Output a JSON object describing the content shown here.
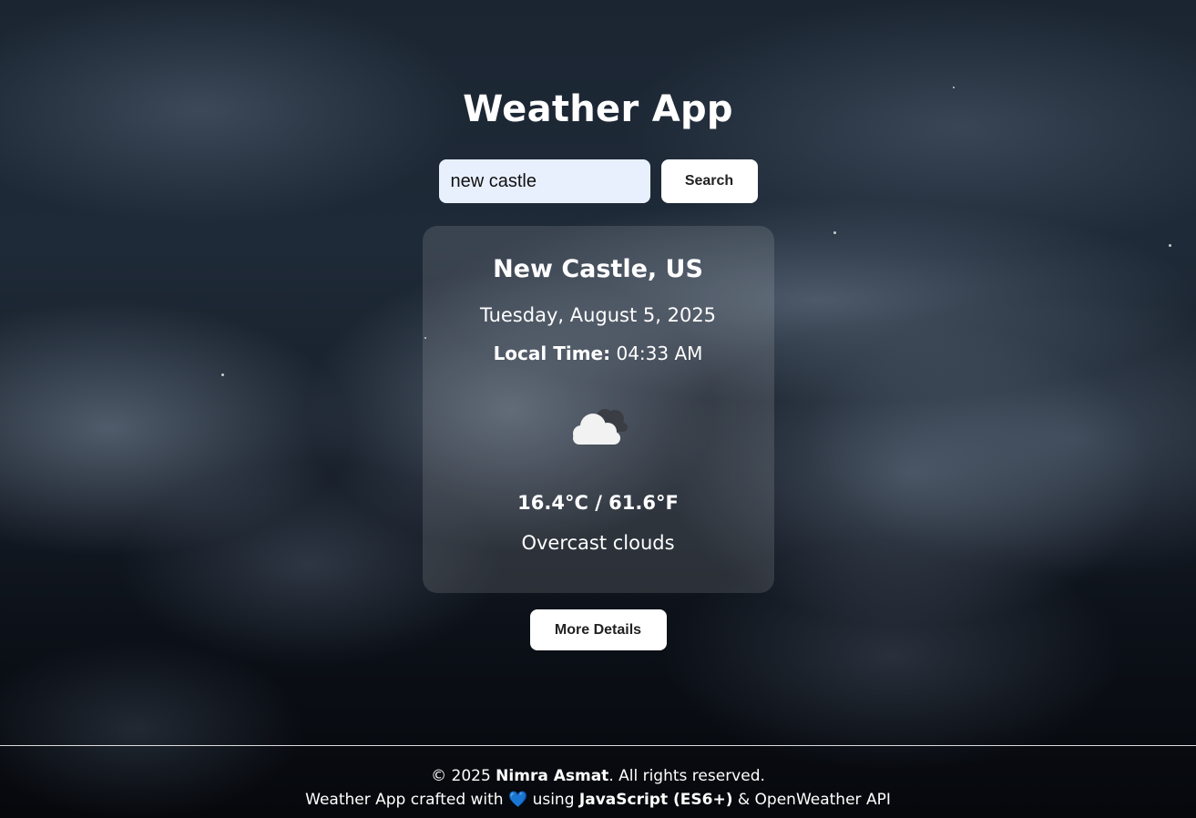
{
  "app": {
    "title": "Weather App"
  },
  "search": {
    "value": "new castle",
    "placeholder": "",
    "button_label": "Search"
  },
  "weather": {
    "city": "New Castle, US",
    "date": "Tuesday, August 5, 2025",
    "local_time_label": "Local Time:",
    "local_time_value": "04:33 AM",
    "icon": "night-cloudy-icon",
    "temperature": "16.4°C / 61.6°F",
    "description": "Overcast clouds"
  },
  "actions": {
    "more_details_label": "More Details"
  },
  "footer": {
    "copyright_prefix": "© 2025",
    "author": "Nimra Asmat",
    "copyright_suffix": ". All rights reserved.",
    "credit_prefix": "Weather App crafted with",
    "heart": "💙",
    "credit_using": "using",
    "tech": "JavaScript (ES6+)",
    "credit_suffix": "& OpenWeather API"
  },
  "colors": {
    "input_bg": "#e8f0fe",
    "button_bg": "#ffffff",
    "heart": "#4a90e2"
  }
}
